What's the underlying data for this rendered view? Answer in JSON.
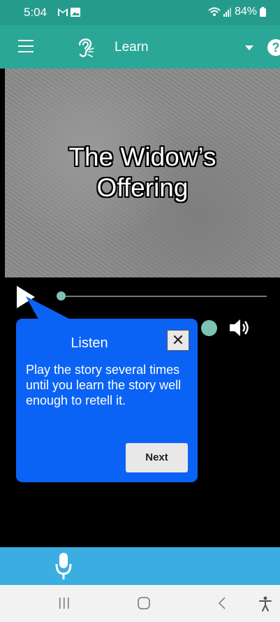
{
  "status_bar": {
    "time": "5:04",
    "battery": "84%"
  },
  "app_bar": {
    "title": "Learn"
  },
  "story": {
    "title_line1": "The Widow’s",
    "title_line2": "Offering"
  },
  "tooltip": {
    "title": "Listen",
    "close_label": "✕",
    "body": "Play the story several times until you learn the story well enough to retell it.",
    "next_label": "Next"
  },
  "player": {
    "progress_fraction": 0.0,
    "volume_fraction": 1.0
  },
  "colors": {
    "app_bar": "#2aa796",
    "tooltip": "#0b63f5",
    "record_bar": "#3aaee0",
    "slider_knob": "#7cc3b5"
  },
  "icons": {
    "menu": "menu-icon",
    "ear": "ear-icon",
    "help": "help-icon",
    "play": "play-icon",
    "speaker": "speaker-icon",
    "mic": "microphone-icon"
  }
}
